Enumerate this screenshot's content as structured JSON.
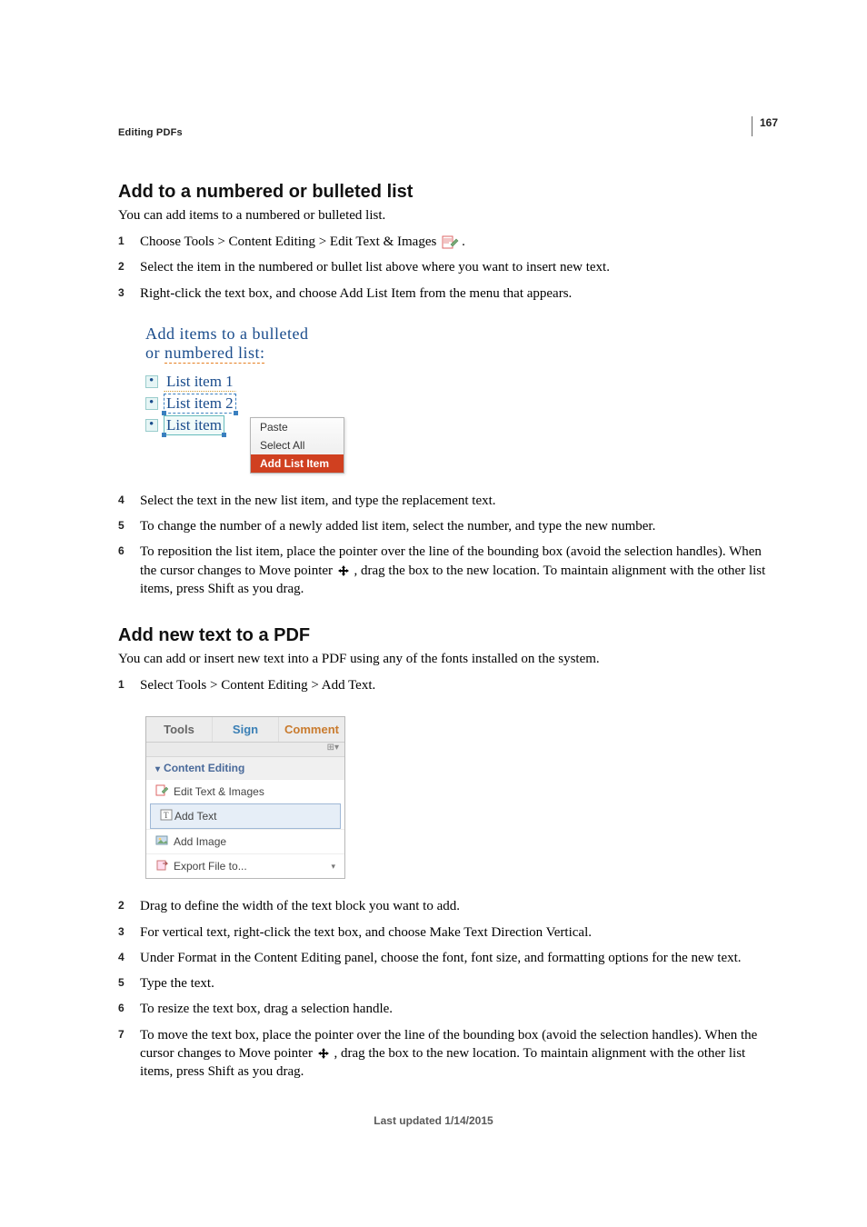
{
  "page_number": "167",
  "section_label": "Editing PDFs",
  "heading1": "Add to a numbered or bulleted list",
  "intro1": "You can add items to a numbered or bulleted list.",
  "steps1": [
    "Choose Tools > Content Editing > Edit Text & Images",
    "Select the item in the numbered or bullet list above where you want to insert new text.",
    "Right-click the text box, and choose Add List Item from the menu that appears."
  ],
  "fig1": {
    "title_line1": "Add items to a bulleted",
    "title_line2_a": "or ",
    "title_line2_b": "numbered list:",
    "items": [
      "List item 1",
      "List item 2",
      "List item"
    ],
    "menu": [
      "Paste",
      "Select All",
      "Add List Item"
    ]
  },
  "steps1b": [
    "Select the text in the new list item, and type the replacement text.",
    "To change the number of a newly added list item, select the number, and type the new number.",
    "To reposition the list item, place the pointer over the line of the bounding box (avoid the selection handles). When the cursor changes to Move pointer ",
    ", drag the box to the new location. To maintain alignment with the other list items, press Shift as you drag."
  ],
  "heading2": "Add new text to a PDF",
  "intro2": "You can add or insert new text into a PDF using any of the fonts installed on the system.",
  "steps2a": [
    "Select Tools > Content Editing > Add Text."
  ],
  "fig2": {
    "tabs": [
      "Tools",
      "Sign",
      "Comment"
    ],
    "panel_head": "Content Editing",
    "rows": [
      "Edit Text & Images",
      "Add Text",
      "Add Image",
      "Export File to..."
    ]
  },
  "steps2b": [
    "Drag to define the width of the text block you want to add.",
    "For vertical text, right-click the text box, and choose Make Text Direction Vertical.",
    "Under Format in the Content Editing panel, choose the font, font size, and formatting options for the new text.",
    "Type the text.",
    "To resize the text box, drag a selection handle.",
    "To move the text box, place the pointer over the line of the bounding box (avoid the selection handles). When the cursor changes to Move pointer ",
    ", drag the box to the new location. To maintain alignment with the other list items, press Shift as you drag."
  ],
  "footer": "Last updated 1/14/2015"
}
